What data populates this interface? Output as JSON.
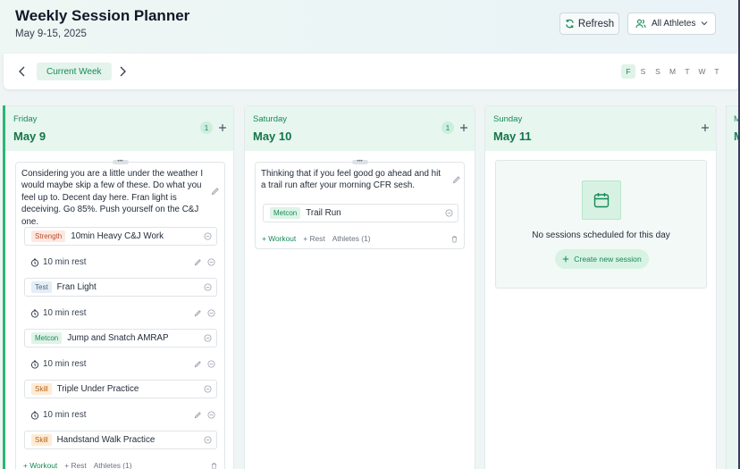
{
  "header": {
    "title": "Weekly Session Planner",
    "date_range": "May 9-15, 2025",
    "refresh_label": "Refresh",
    "athletes_filter": "All Athletes"
  },
  "nav": {
    "current_week_label": "Current Week",
    "day_pills": [
      "F",
      "S",
      "S",
      "M",
      "T",
      "W",
      "T"
    ],
    "active_pill": 0
  },
  "columns": [
    {
      "day": "Friday",
      "date": "May 9",
      "count": "1",
      "session": {
        "note": "Considering you are a little under the weather I would maybe skip a few of these. Do what you feel up to. Decent day here. Fran light is deceiving. Go 85%. Push yourself on the C&J one.",
        "items": [
          {
            "tag": "Strength",
            "name": "10min Heavy C&J Work"
          },
          {
            "tag": "Test",
            "name": "Fran Light"
          },
          {
            "tag": "Metcon",
            "name": "Jump and Snatch AMRAP"
          },
          {
            "tag": "Skill",
            "name": "Triple Under Practice"
          },
          {
            "tag": "Skill",
            "name": "Handstand Walk Practice"
          }
        ],
        "rest_label": "10 min rest",
        "add_workout": "+ Workout",
        "add_rest": "+ Rest",
        "athletes": "Athletes (1)"
      }
    },
    {
      "day": "Saturday",
      "date": "May 10",
      "count": "1",
      "session": {
        "note": "Thinking that if you feel good go ahead and hit a trail run after your morning CFR sesh.",
        "items": [
          {
            "tag": "Metcon",
            "name": "Trail Run"
          }
        ],
        "add_workout": "+ Workout",
        "add_rest": "+ Rest",
        "athletes": "Athletes (1)"
      }
    },
    {
      "day": "Sunday",
      "date": "May 11",
      "empty_text": "No sessions scheduled for this day",
      "create_label": "Create new session"
    }
  ],
  "edge_column": {
    "day": "M",
    "date": "M"
  },
  "colors": {
    "accent": "#178a57",
    "header_bg": "#e7f6ef"
  },
  "icons": [
    "refresh-icon",
    "users-icon",
    "chevron-down-icon",
    "chevron-left-icon",
    "chevron-right-icon",
    "plus-icon",
    "pencil-icon",
    "remove-circle-icon",
    "stopwatch-icon",
    "trash-icon",
    "calendar-icon"
  ]
}
